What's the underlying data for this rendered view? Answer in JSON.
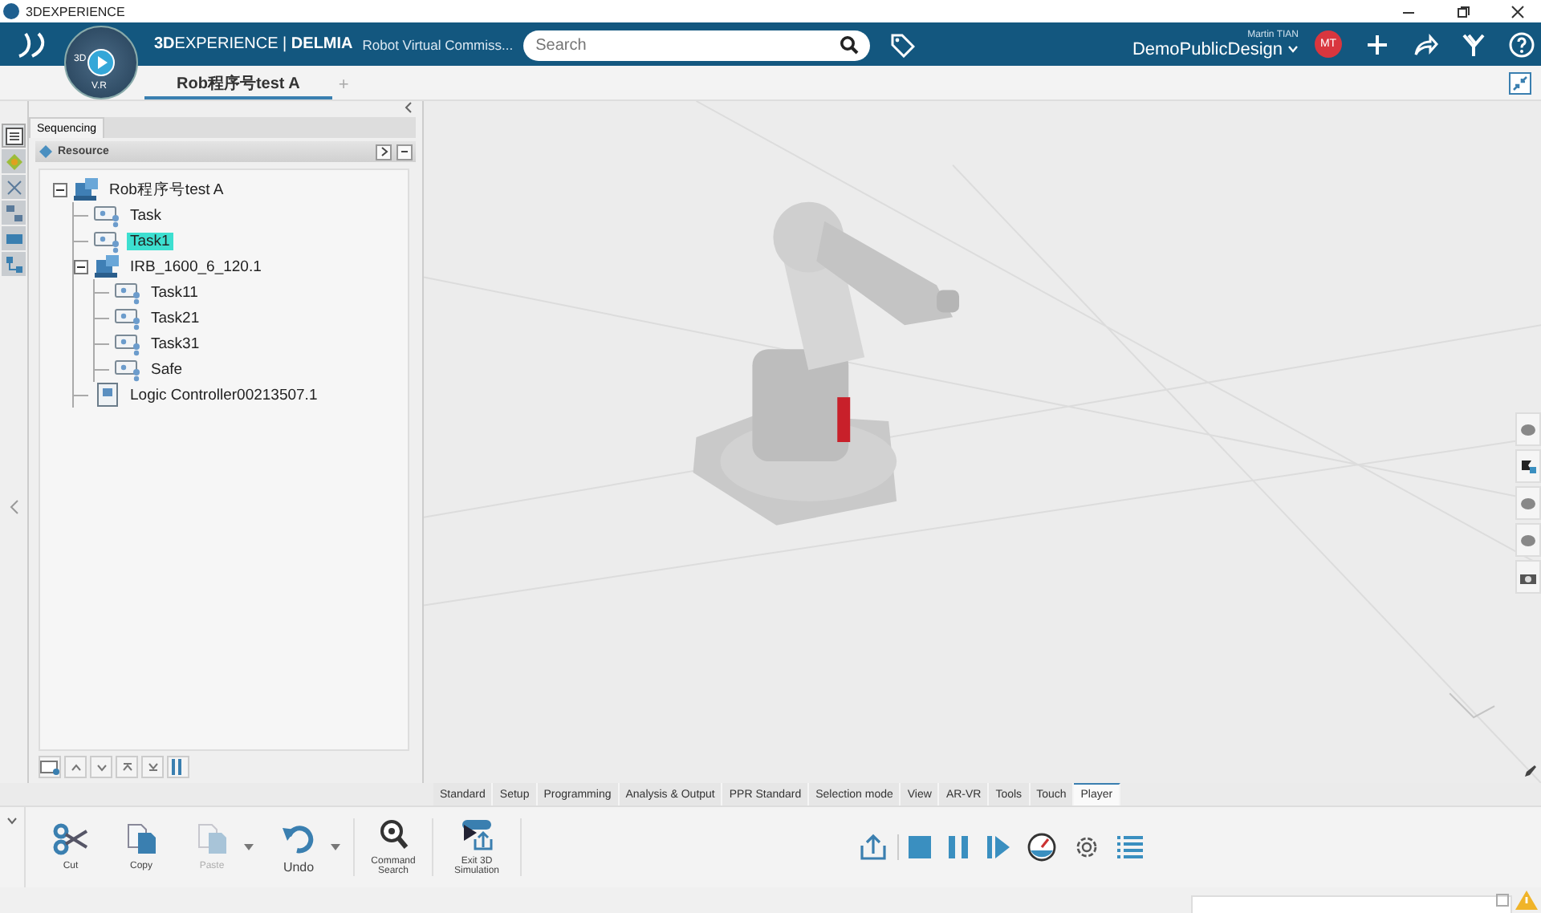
{
  "window": {
    "title": "3DEXPERIENCE"
  },
  "header": {
    "compass_top": "3D",
    "compass_bottom": "V.R",
    "brand": "**3D**EXPERIENCE | **DELMIA**",
    "app_name": "Robot Virtual Commiss...",
    "search": {
      "placeholder": "Search"
    },
    "user": "Martin TIAN",
    "space": "DemoPublicDesign",
    "avatar": "MT"
  },
  "doc_tabs": [
    {
      "label": "Rob程序号test A",
      "selected": true
    }
  ],
  "add_tab": "+",
  "panel": {
    "tab": "Sequencing",
    "section": "Resource",
    "tree": [
      {
        "label": "Rob程序号test A",
        "kind": "robot",
        "selected": false,
        "expanded": true,
        "children": [
          {
            "label": "Task",
            "kind": "task",
            "selected": false
          },
          {
            "label": "Task1",
            "kind": "task",
            "selected": true
          },
          {
            "label": "IRB_1600_6_120.1",
            "kind": "robot",
            "selected": false,
            "expanded": true,
            "children": [
              {
                "label": "Task11",
                "kind": "task",
                "selected": false
              },
              {
                "label": "Task21",
                "kind": "task",
                "selected": false
              },
              {
                "label": "Task31",
                "kind": "task",
                "selected": false
              },
              {
                "label": "Safe",
                "kind": "task",
                "selected": false
              }
            ]
          },
          {
            "label": "Logic Controller00213507.1",
            "kind": "controller",
            "selected": false
          }
        ]
      }
    ]
  },
  "ribbon_tabs": [
    {
      "label": "Standard",
      "selected": false
    },
    {
      "label": "Setup",
      "selected": false
    },
    {
      "label": "Programming",
      "selected": false
    },
    {
      "label": "Analysis & Output",
      "selected": false
    },
    {
      "label": "PPR Standard",
      "selected": false
    },
    {
      "label": "Selection mode",
      "selected": false
    },
    {
      "label": "View",
      "selected": false
    },
    {
      "label": "AR-VR",
      "selected": false
    },
    {
      "label": "Tools",
      "selected": false
    },
    {
      "label": "Touch",
      "selected": false
    },
    {
      "label": "Player",
      "selected": true
    }
  ],
  "tools": [
    {
      "label": "Cut",
      "kind": "cut",
      "disabled": false
    },
    {
      "label": "Copy",
      "kind": "copy",
      "disabled": false
    },
    {
      "label": "Paste",
      "kind": "paste",
      "disabled": true
    },
    {
      "label": "Undo",
      "kind": "undo",
      "disabled": false
    },
    {
      "label": "Command Search",
      "kind": "search",
      "disabled": false
    },
    {
      "label": "Exit 3D Simulation",
      "kind": "exit",
      "disabled": false
    }
  ]
}
